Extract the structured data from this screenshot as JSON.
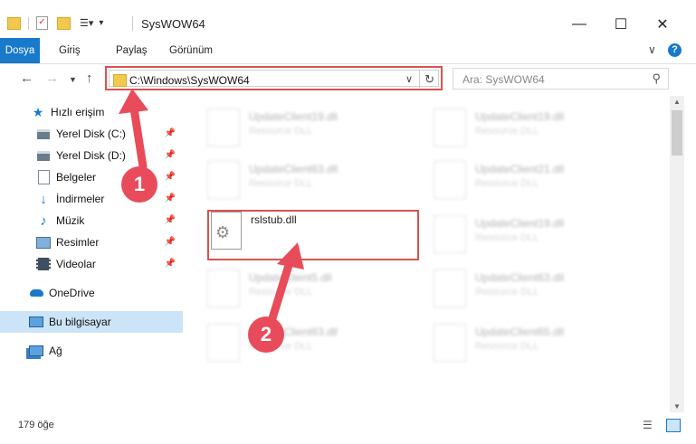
{
  "window": {
    "title": "SysWOW64"
  },
  "ribbon": {
    "tabs": [
      "Dosya",
      "Giriş",
      "Paylaş",
      "Görünüm"
    ]
  },
  "address": {
    "path": "C:\\Windows\\SysWOW64"
  },
  "search": {
    "placeholder": "Ara: SysWOW64"
  },
  "sidebar": {
    "items": [
      {
        "label": "Hızlı erişim",
        "icon": "star-icon"
      },
      {
        "label": "Yerel Disk (C:)",
        "icon": "drive-icon",
        "pinned": true
      },
      {
        "label": "Yerel Disk (D:)",
        "icon": "drive-icon",
        "pinned": true
      },
      {
        "label": "Belgeler",
        "icon": "documents-icon",
        "pinned": true
      },
      {
        "label": "İndirmeler",
        "icon": "download-icon",
        "pinned": true
      },
      {
        "label": "Müzik",
        "icon": "music-icon",
        "pinned": true
      },
      {
        "label": "Resimler",
        "icon": "pictures-icon",
        "pinned": true
      },
      {
        "label": "Videolar",
        "icon": "videos-icon",
        "pinned": true
      },
      {
        "label": "OneDrive",
        "icon": "cloud-icon"
      },
      {
        "label": "Bu bilgisayar",
        "icon": "computer-icon",
        "selected": true
      },
      {
        "label": "Ağ",
        "icon": "network-icon"
      }
    ]
  },
  "files": [
    {
      "name": "UpdateClient19.dll",
      "desc": "Resource DLL",
      "blurred": true
    },
    {
      "name": "UpdateClient19.dll",
      "desc": "Resource DLL",
      "blurred": true
    },
    {
      "name": "UpdateClient63.dll",
      "desc": "Resource DLL",
      "blurred": true
    },
    {
      "name": "UpdateClient21.dll",
      "desc": "Resource DLL",
      "blurred": true
    },
    {
      "name": "rslstub.dll",
      "desc": "",
      "blurred": false
    },
    {
      "name": "UpdateClient19.dll",
      "desc": "Resource DLL",
      "blurred": true
    },
    {
      "name": "UpdateClient5.dll",
      "desc": "Resource DLL",
      "blurred": true
    },
    {
      "name": "UpdateClient63.dll",
      "desc": "Resource DLL",
      "blurred": true
    },
    {
      "name": "UpdateClient63.dll",
      "desc": "Resource DLL",
      "blurred": true
    },
    {
      "name": "UpdateClient65.dll",
      "desc": "Resource DLL",
      "blurred": true
    }
  ],
  "status": {
    "count": "179 öğe"
  },
  "annotations": {
    "step1": "1",
    "step2": "2",
    "accent": "#e84c5a"
  }
}
